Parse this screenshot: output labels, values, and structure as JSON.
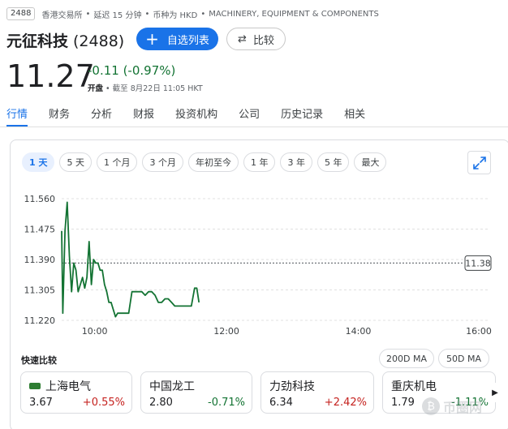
{
  "header": {
    "ticker_badge": "2488",
    "exchange": "香港交易所",
    "delay": "延迟 15 分钟",
    "currency": "币种为 HKD",
    "sector": "MACHINERY, EQUIPMENT & COMPONENTS",
    "company_name": "元征科技",
    "company_code": "(2488)",
    "follow_label": "自选列表",
    "compare_label": "比较"
  },
  "quote": {
    "price": "11.27",
    "change": "-0.11 (-0.97%)",
    "status_label": "开盘",
    "status_time": "截至 8月22日 11:05 HKT"
  },
  "tabs": [
    "行情",
    "财务",
    "分析",
    "财报",
    "投资机构",
    "公司",
    "历史记录",
    "相关"
  ],
  "ranges": [
    "1 天",
    "5 天",
    "1 个月",
    "3 个月",
    "年初至今",
    "1 年",
    "3 年",
    "5 年",
    "最大"
  ],
  "colors": {
    "accent": "#1a73e8",
    "price_line": "#137333",
    "up": "#c5221f",
    "down": "#137333"
  },
  "icons": {
    "add": "plus-icon",
    "compare": "swap-arrows-icon",
    "expand": "expand-diagonal-icon",
    "next": "chevron-right-icon"
  },
  "chart_data": {
    "type": "line",
    "x_ticks": [
      "10:00",
      "12:00",
      "14:00",
      "16:00"
    ],
    "y_ticks": [
      "11.560",
      "11.475",
      "11.390",
      "11.305",
      "11.220"
    ],
    "ylim": [
      11.22,
      11.56
    ],
    "xlim_minutes": [
      570,
      960
    ],
    "reference_label": "11.38",
    "reference_value": 11.38,
    "grid": true,
    "series": [
      {
        "x": [
          570,
          571,
          573,
          575,
          577,
          579,
          581,
          583,
          585,
          587,
          589,
          591,
          593,
          595,
          597,
          599,
          601,
          603,
          605,
          607,
          609,
          611,
          613,
          615,
          617,
          619,
          621,
          623,
          625,
          628,
          631,
          634,
          637,
          640,
          643,
          646,
          649,
          652,
          655,
          658,
          661,
          664,
          667,
          670,
          673,
          676,
          679,
          682,
          685,
          688,
          691,
          693,
          695
        ],
        "values": [
          11.47,
          11.24,
          11.47,
          11.55,
          11.4,
          11.3,
          11.38,
          11.36,
          11.3,
          11.32,
          11.34,
          11.31,
          11.34,
          11.44,
          11.32,
          11.39,
          11.38,
          11.38,
          11.36,
          11.36,
          11.32,
          11.3,
          11.27,
          11.27,
          11.25,
          11.23,
          11.24,
          11.24,
          11.24,
          11.24,
          11.24,
          11.3,
          11.3,
          11.3,
          11.3,
          11.29,
          11.3,
          11.3,
          11.29,
          11.27,
          11.27,
          11.28,
          11.28,
          11.27,
          11.26,
          11.26,
          11.26,
          11.26,
          11.26,
          11.26,
          11.31,
          11.31,
          11.27
        ]
      }
    ]
  },
  "quick_compare": {
    "title": "快速比较",
    "ma_buttons": [
      "200D MA",
      "50D MA"
    ],
    "items": [
      {
        "name": "上海电气",
        "price": "3.67",
        "change": "+0.55%",
        "dir": "up"
      },
      {
        "name": "中国龙工",
        "price": "2.80",
        "change": "-0.71%",
        "dir": "down"
      },
      {
        "name": "力劲科技",
        "price": "6.34",
        "change": "+2.42%",
        "dir": "up"
      },
      {
        "name": "重庆机电",
        "price": "1.79",
        "change": "-1.11%",
        "dir": "down"
      }
    ]
  },
  "watermark": "币圈网"
}
